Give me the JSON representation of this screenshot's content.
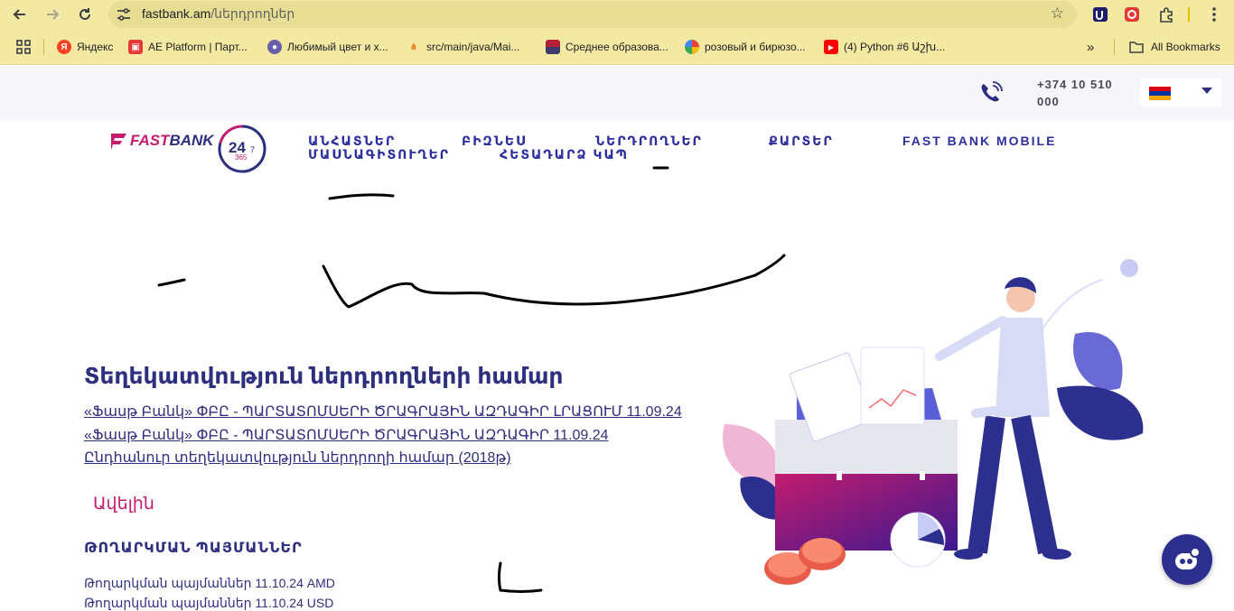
{
  "browser": {
    "url_domain": "fastbank.am",
    "url_path": "/ներդրողներ",
    "bookmarks": [
      {
        "label": "Яндекс",
        "color": "#fc3f1d"
      },
      {
        "label": "AE Platform | Парт...",
        "color": "#e53935"
      },
      {
        "label": "Любимый цвет и х...",
        "color": "#6b5ea8"
      },
      {
        "label": "src/main/java/Mai...",
        "color": "#f46800"
      },
      {
        "label": "Среднее образова...",
        "color": "#3c6bd1"
      },
      {
        "label": "розовый и бирюзо...",
        "color": "#4285f4"
      },
      {
        "label": "(4) Python #6 Աշխ...",
        "color": "#ff0000"
      }
    ],
    "all_bookmarks": "All Bookmarks"
  },
  "site": {
    "phone": "+374 10 510 000",
    "logo_fast": "FAST",
    "logo_bank": "BANK",
    "badge_24": "24",
    "badge_7": "7",
    "badge_365": "365",
    "nav": {
      "individuals_1": "ԱՆՀԱՏՆԵՐ",
      "individuals_2": "ՄԱՍՆԱԳԻՏՈՒՂԵՐ",
      "business": "ԲԻԶՆԵՍ",
      "contact": "ՀԵՏԱԴԱՐՁ ԿԱՊ",
      "investors": "ՆԵՐԴՐՈՂՆԵՐ",
      "cards": "ՔԱՐՏԵՐ",
      "mobile": "FAST BANK MOBILE"
    }
  },
  "content": {
    "title": "Տեղեկատվություն ներդրողների համար",
    "links": [
      "«Ֆասթ Բանկ» ՓԲԸ - ՊԱՐՏԱՏՈՄՍԵՐԻ ԾՐԱԳՐԱՅԻՆ ԱԶԴԱԳԻՐ ԼՐԱՑՈՒՄ 11.09.24 ",
      "«Ֆասթ Բանկ» ՓԲԸ - ՊԱՐՏԱՏՈՄՍԵՐԻ ԾՐԱԳՐԱՅԻՆ ԱԶԴԱԳԻՐ 11.09.24",
      "Ընդհանուր տեղեկատվություն ներդրողի համար (2018թ)"
    ],
    "more": "Ավելին",
    "section_title": "ԹՈՂԱՐԿՄԱՆ ՊԱՅՄԱՆՆԵՐ",
    "terms": [
      "Թողարկման պայմաններ 11.10.24 AMD",
      "Թողարկման պայմաններ 11.10.24 USD"
    ]
  },
  "colors": {
    "brand_navy": "#2d2f7f",
    "brand_magenta": "#c41b6e",
    "chrome": "#f3e9a3"
  }
}
